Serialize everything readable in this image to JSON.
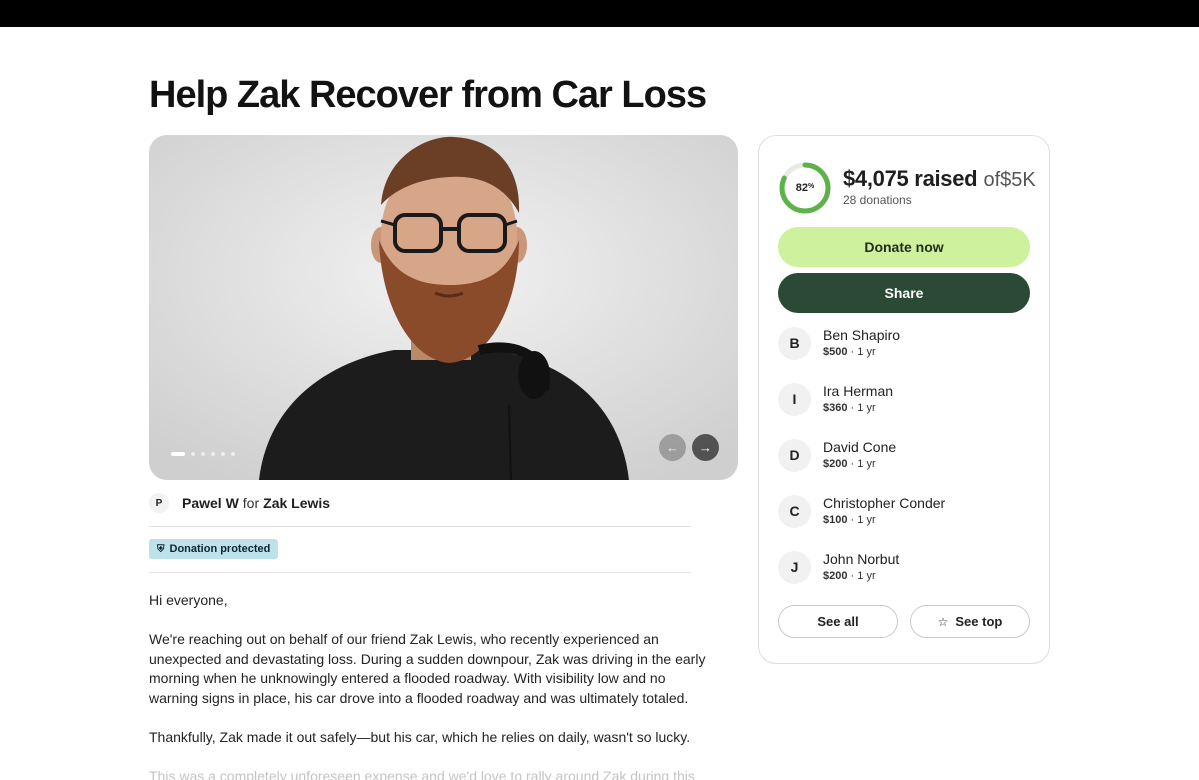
{
  "page": {
    "title": "Help Zak Recover from Car Loss"
  },
  "media": {
    "slide_count": 6,
    "active_slide": 1,
    "prev_icon": "arrow-left-icon",
    "next_icon": "arrow-right-icon"
  },
  "organizer": {
    "avatar_initial": "P",
    "name": "Pawel W",
    "for_text": "for",
    "beneficiary": "Zak Lewis"
  },
  "badge": {
    "icon": "shield-icon",
    "label": "Donation protected"
  },
  "story": {
    "greeting": "Hi everyone,",
    "paragraph1": "We're reaching out on behalf of our friend Zak Lewis, who recently experienced an unexpected and devastating loss. During a sudden downpour, Zak was driving in the early morning when he unknowingly entered a flooded roadway. With visibility low and no warning signs in place, his car drove into a flooded roadway and was ultimately totaled.",
    "paragraph2": "Thankfully, Zak made it out safely—but his car, which he relies on daily, wasn't so lucky.",
    "paragraph3": "This was a completely unforeseen expense and we'd love to rally around Zak during this"
  },
  "fundraiser": {
    "percent_label": "82",
    "percent_suffix": "%",
    "progress_fraction": 0.82,
    "raised": "$4,075 raised",
    "of_text": "of",
    "goal": "$5K",
    "donations": "28 donations",
    "donate_label": "Donate now",
    "share_label": "Share",
    "see_all_label": "See all",
    "see_top_label": "See top",
    "see_top_icon": "star-icon"
  },
  "donors": [
    {
      "initial": "B",
      "name": "Ben Shapiro",
      "amount": "$500",
      "time": "· 1 yr"
    },
    {
      "initial": "I",
      "name": "Ira Herman",
      "amount": "$360",
      "time": "· 1 yr"
    },
    {
      "initial": "D",
      "name": "David Cone",
      "amount": "$200",
      "time": "· 1 yr"
    },
    {
      "initial": "C",
      "name": "Christopher Conder",
      "amount": "$100",
      "time": "· 1 yr"
    },
    {
      "initial": "J",
      "name": "John Norbut",
      "amount": "$200",
      "time": "· 1 yr"
    }
  ],
  "colors": {
    "accent_light": "#cdf19c",
    "accent_dark": "#2a4a36",
    "progress": "#5db24a",
    "badge": "#bde2ea"
  }
}
